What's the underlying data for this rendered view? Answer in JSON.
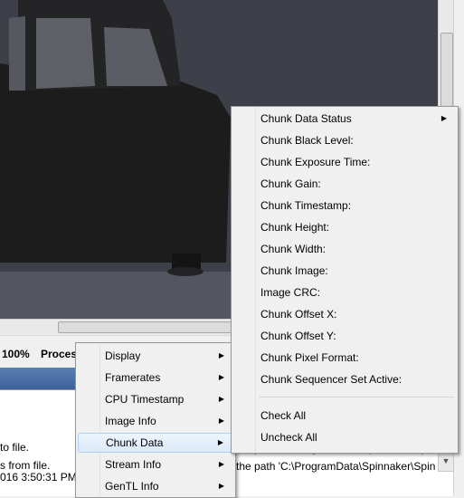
{
  "status_bar": {
    "zoom": "100%",
    "processing_label": "Process"
  },
  "log": {
    "lines": [
      " to file.",
      "s from file.",
      "016 3:50:31 PM"
    ],
    "right_lines": [
      "the path 'C:\\ProgramData\\Spinnaker\\Spin",
      "the path 'C:\\ProgramData\\Spinnaker\\Spin"
    ]
  },
  "context_menu": {
    "items": [
      {
        "label": "Display",
        "has_submenu": true
      },
      {
        "label": "Framerates",
        "has_submenu": true
      },
      {
        "label": "CPU Timestamp",
        "has_submenu": true
      },
      {
        "label": "Image Info",
        "has_submenu": true
      },
      {
        "label": "Chunk Data",
        "has_submenu": true,
        "highlighted": true
      },
      {
        "label": "Stream Info",
        "has_submenu": true
      },
      {
        "label": "GenTL Info",
        "has_submenu": true
      }
    ]
  },
  "chunk_submenu": {
    "items": [
      {
        "label": "Chunk Data Status",
        "has_submenu": true
      },
      {
        "label": "Chunk Black Level:"
      },
      {
        "label": "Chunk Exposure Time:"
      },
      {
        "label": "Chunk Gain:"
      },
      {
        "label": "Chunk Timestamp:"
      },
      {
        "label": "Chunk Height:"
      },
      {
        "label": "Chunk Width:"
      },
      {
        "label": "Chunk Image:"
      },
      {
        "label": "Image CRC:"
      },
      {
        "label": "Chunk Offset X:"
      },
      {
        "label": "Chunk Offset Y:"
      },
      {
        "label": "Chunk Pixel Format:"
      },
      {
        "label": "Chunk Sequencer Set Active:"
      }
    ],
    "actions": [
      {
        "label": "Check All"
      },
      {
        "label": "Uncheck All"
      }
    ]
  },
  "icons": {
    "submenu_arrow": "triangle-right-icon"
  },
  "colors": {
    "menu_background": "#f0f0f0",
    "highlight": "#dbe9f9",
    "tab_strip": "#3d629a"
  }
}
